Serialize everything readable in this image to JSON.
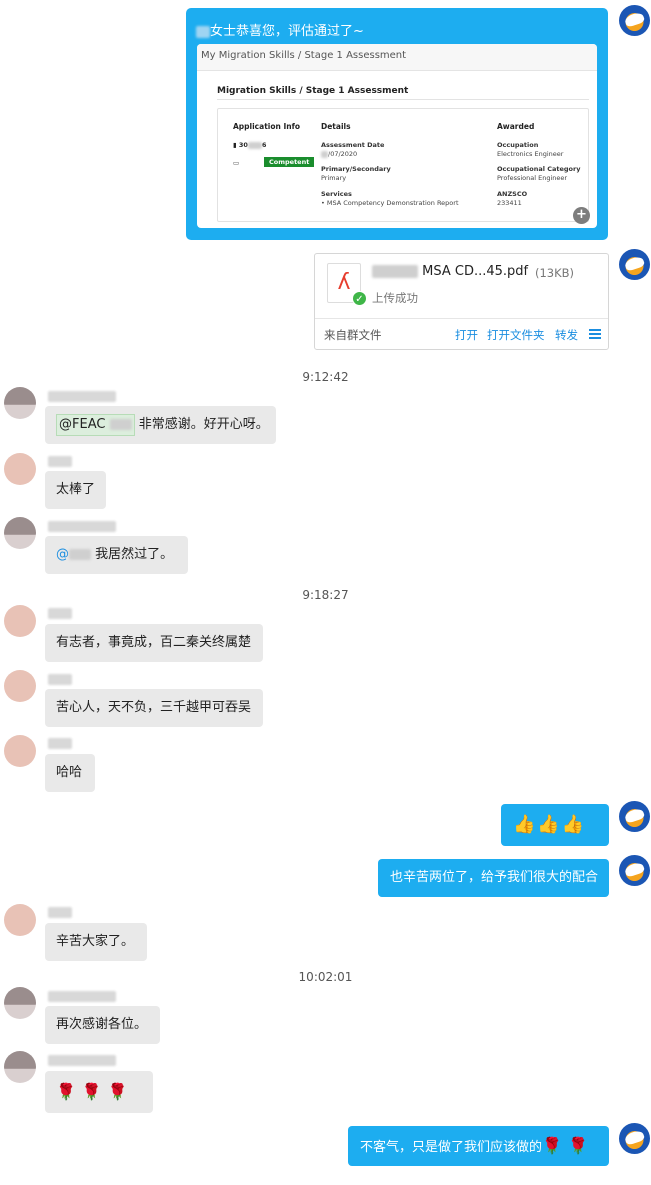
{
  "card": {
    "caption": "女士恭喜您，评估通过了~",
    "shot_header": "My Migration Skills / Stage 1 Assessment",
    "shot_title": "Migration Skills / Stage 1 Assessment",
    "col1_title": "Application Info",
    "app_number_start": "30",
    "app_number_end": "6",
    "status": "Competent",
    "col2_title": "Details",
    "assessment_date_label": "Assessment Date",
    "assessment_date_value": "/07/2020",
    "primary_label": "Primary/Secondary",
    "primary_value": "Primary",
    "services_label": "Services",
    "services_value": "MSA Competency Demonstration Report",
    "col3_title": "Awarded",
    "occupation_label": "Occupation",
    "occupation_value": "Electronics Engineer",
    "category_label": "Occupational Category",
    "category_value": "Professional Engineer",
    "anzsco_label": "ANZSCO",
    "anzsco_value": "233411"
  },
  "file": {
    "name": "MSA CD...45.pdf",
    "size": "(13KB)",
    "status": "上传成功",
    "source": "来自群文件",
    "actions": [
      "打开",
      "打开文件夹",
      "转发"
    ]
  },
  "timestamps": [
    "9:12:42",
    "9:18:27",
    "10:02:01"
  ],
  "messages": {
    "m1_mention": "@FEAC",
    "m1_text": "非常感谢。好开心呀。",
    "m2": "太棒了",
    "m3_mention": "@",
    "m3_text": "我居然过了。",
    "m4": "有志者，事竟成，百二秦关终属楚",
    "m5": "苦心人，天不负，三千越甲可吞吴",
    "m6": "哈哈",
    "m7_emoji": "👍👍👍",
    "m8": "也辛苦两位了，给予我们很大的配合",
    "m9": "辛苦大家了。",
    "m10": "再次感谢各位。",
    "m11_emoji": "🌹🌹🌹",
    "m12": "不客气，只是做了我们应该做的",
    "m12_emoji": "🌹🌹"
  },
  "colors": {
    "bubble_self": "#1dadf0",
    "bubble_other": "#e9e9e9",
    "link": "#1b8ee0",
    "competent": "#1a8d2d"
  },
  "icons": [
    "pdf-icon",
    "upload-success-icon",
    "zoom-in-icon",
    "menu-icon",
    "avatar"
  ]
}
